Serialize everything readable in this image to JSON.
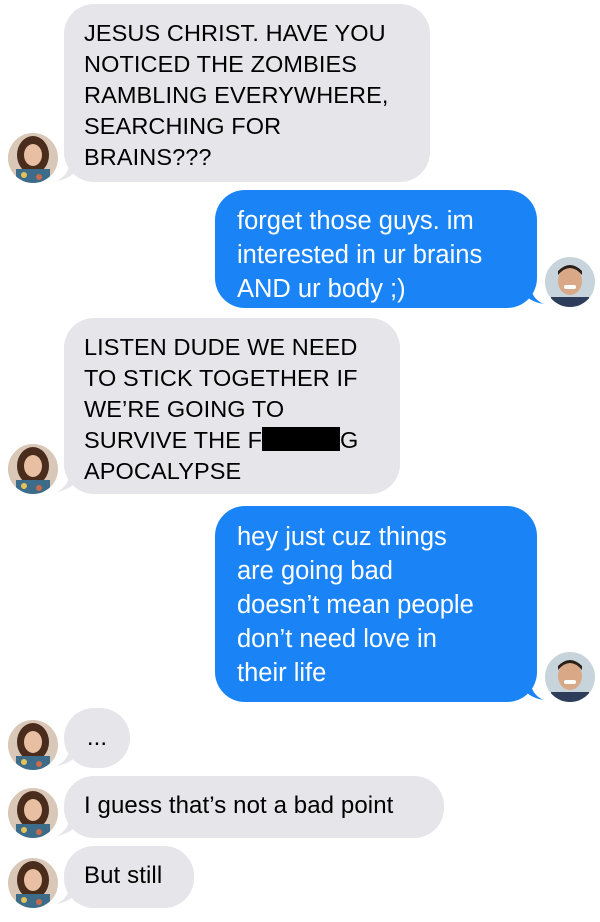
{
  "messages": [
    {
      "side": "in",
      "lines": [
        "JESUS CHRIST. HAVE YOU",
        "NOTICED THE ZOMBIES",
        "RAMBLING EVERYWHERE,",
        "SEARCHING FOR",
        "BRAINS???"
      ]
    },
    {
      "side": "out",
      "lines": [
        "forget those guys. im",
        "interested in ur brains",
        "AND ur body ;)"
      ]
    },
    {
      "side": "in",
      "lines": [
        "LISTEN DUDE WE NEED",
        "TO STICK TOGETHER IF",
        "WE’RE GOING TO"
      ],
      "censored_line": {
        "before": "SURVIVE THE F",
        "after": "G"
      },
      "last_line": "APOCALYPSE"
    },
    {
      "side": "out",
      "lines": [
        "hey just cuz things",
        "are going bad",
        "doesn’t mean people",
        "don’t need love in",
        "their life"
      ]
    },
    {
      "side": "in",
      "lines": [
        "..."
      ]
    },
    {
      "side": "in",
      "lines": [
        "I guess that’s not a bad point"
      ]
    },
    {
      "side": "in",
      "lines": [
        "But still"
      ]
    }
  ],
  "colors": {
    "incoming_bubble": "#e5e5ea",
    "outgoing_bubble": "#1a84f7",
    "incoming_text": "#000000",
    "outgoing_text": "#ffffff"
  },
  "avatars": {
    "incoming": "woman-avatar-icon",
    "outgoing": "man-avatar-icon"
  }
}
